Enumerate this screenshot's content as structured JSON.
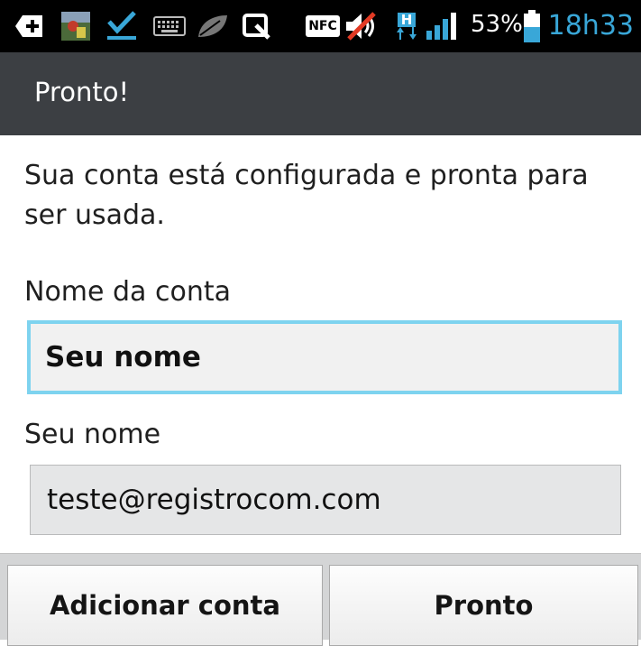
{
  "status_bar": {
    "icons": [
      "plus-notification-icon",
      "photo-thumbnail-icon",
      "download-check-icon",
      "keyboard-icon",
      "leaf-icon",
      "qslide-icon",
      "nfc-icon",
      "mute-icon",
      "hspa-data-icon",
      "signal-icon",
      "battery-icon"
    ],
    "nfc_label": "NFC",
    "hspa_label": "H",
    "battery_percent": "53%",
    "time": "18h33",
    "accent_color": "#39a7d8"
  },
  "action_bar": {
    "title": "Pronto!"
  },
  "content": {
    "intro": "Sua conta está configurada e pronta para ser usada.",
    "account_name_label": "Nome da conta",
    "account_name_value": "Seu nome",
    "your_name_label": "Seu nome",
    "your_name_value": "teste@registrocom.com"
  },
  "buttons": {
    "add_account": "Adicionar conta",
    "done": "Pronto"
  }
}
